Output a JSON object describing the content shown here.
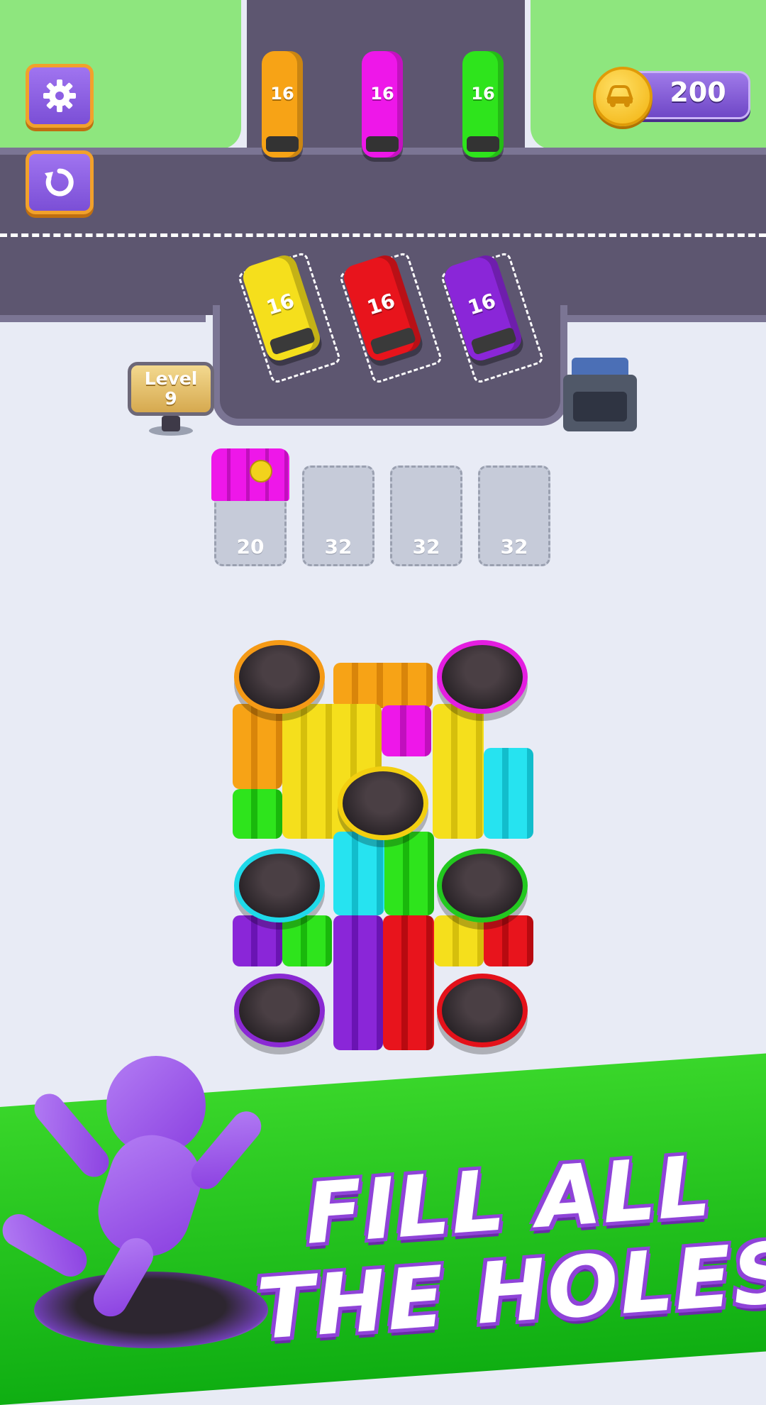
{
  "hud": {
    "coins": "200",
    "settings_icon": "gear-icon",
    "restart_icon": "restart-icon",
    "coin_icon": "car-coin-icon"
  },
  "level": {
    "label": "Level",
    "number": "9"
  },
  "parked_buses": [
    {
      "color": "#f7a316",
      "capacity": "16"
    },
    {
      "color": "#ee17e9",
      "capacity": "16"
    },
    {
      "color": "#2ee41c",
      "capacity": "16"
    }
  ],
  "dock_buses": [
    {
      "color": "#f5df1c",
      "capacity": "16"
    },
    {
      "color": "#e8141c",
      "capacity": "16"
    },
    {
      "color": "#8a26d8",
      "capacity": "16"
    }
  ],
  "waiting_slots": [
    {
      "count": "20",
      "occupied_color": "#ee17e9"
    },
    {
      "count": "32"
    },
    {
      "count": "32"
    },
    {
      "count": "32"
    }
  ],
  "holes": [
    {
      "color": "#f59a16"
    },
    {
      "color": "#e41ee0"
    },
    {
      "color": "#f2cf10"
    },
    {
      "color": "#1fd9e9"
    },
    {
      "color": "#22c81f"
    },
    {
      "color": "#8a29d3"
    },
    {
      "color": "#e3111a"
    }
  ],
  "banner": {
    "line1": "FILL ALL",
    "line2": "THE HOLES!"
  }
}
